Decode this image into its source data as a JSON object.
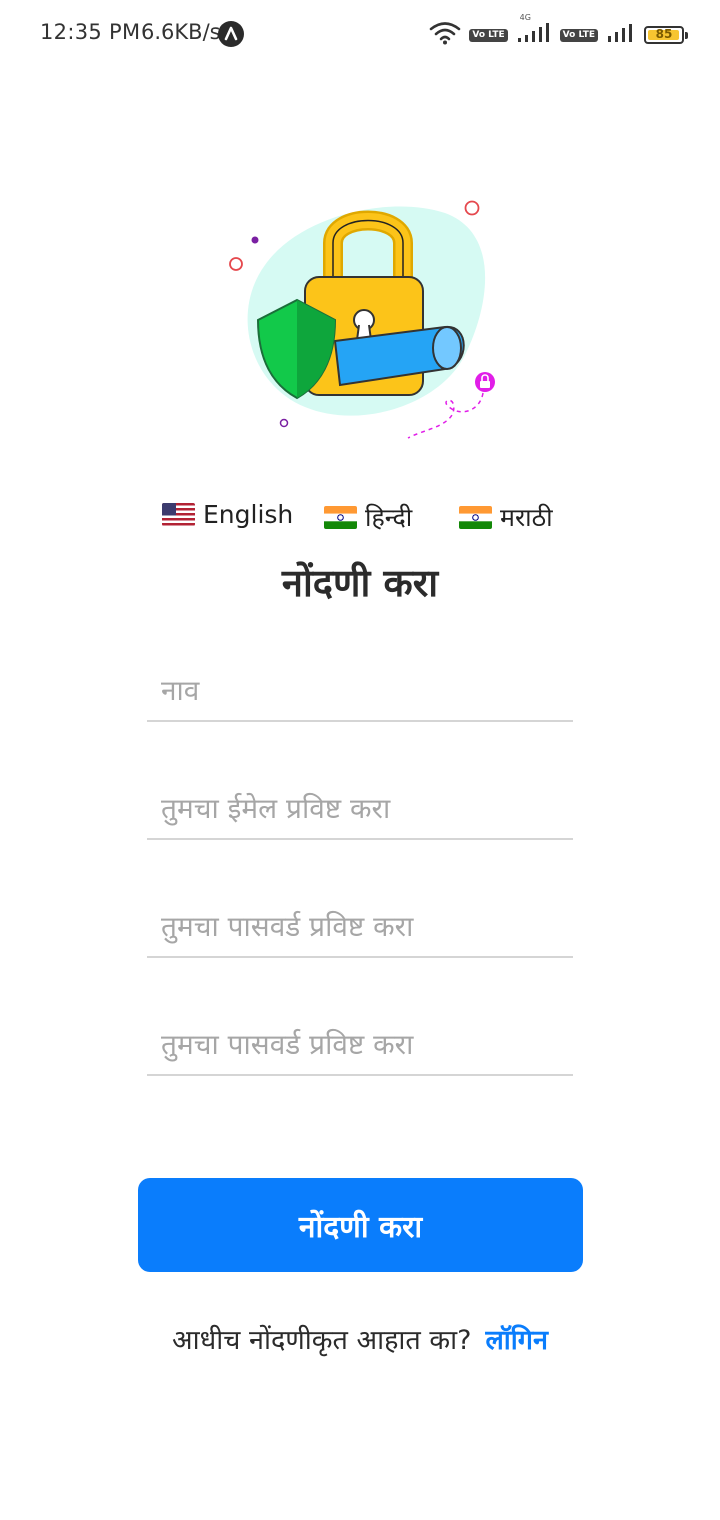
{
  "status_bar": {
    "time": "12:35 PM",
    "net_speed": "6.6KB/s",
    "battery_level": "85",
    "volte_label": "Vo LTE",
    "network_label": "4G",
    "icons": [
      "app-notification-icon",
      "wifi-icon",
      "volte-icon",
      "signal-icon",
      "volte-icon",
      "signal-icon",
      "battery-icon"
    ]
  },
  "illustration": {
    "icon": "security-lock-shield-illustration"
  },
  "languages": [
    {
      "label": "English",
      "flag": "us-flag-icon"
    },
    {
      "label": "हिन्दी",
      "flag": "india-flag-icon"
    },
    {
      "label": "मराठी",
      "flag": "india-flag-icon"
    }
  ],
  "form": {
    "title": "नोंदणी करा",
    "name_placeholder": "नाव",
    "email_placeholder": "तुमचा ईमेल प्रविष्ट करा",
    "password_placeholder": "तुमचा पासवर्ड प्रविष्ट करा",
    "confirm_password_placeholder": "तुमचा पासवर्ड प्रविष्ट करा",
    "submit_label": "नोंदणी करा"
  },
  "footer": {
    "question": "आधीच नोंदणीकृत आहात का?",
    "login_link": "लॉगिन"
  },
  "colors": {
    "primary": "#0a7dfc",
    "lock_body": "#fcc419",
    "shield": "#12c94a",
    "key_bar": "#25a4f5",
    "blob": "#d6faf3",
    "accent": "#e11ee8"
  }
}
